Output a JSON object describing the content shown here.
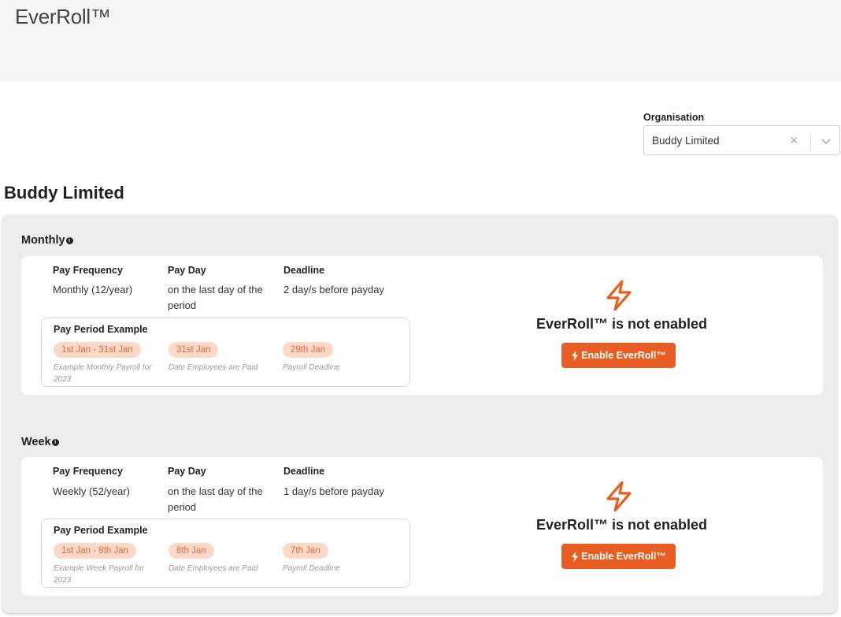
{
  "app": {
    "title": "EverRoll™"
  },
  "organisation": {
    "label": "Organisation",
    "value": "Buddy Limited",
    "clear_icon": "×"
  },
  "company": {
    "title": "Buddy Limited"
  },
  "colors": {
    "accent": "#e85d22",
    "pill_bg": "#fbd9c8",
    "pill_text": "#d66a3c"
  },
  "schedules": [
    {
      "title": "Monthly",
      "headers": {
        "frequency": "Pay Frequency",
        "payday": "Pay Day",
        "deadline": "Deadline"
      },
      "frequency": "Monthly (12/year)",
      "payday": "on the last day of the period",
      "deadline": "2 day/s before payday",
      "example": {
        "title": "Pay Period Example",
        "period": "1st Jan - 31st Jan",
        "period_caption": "Example Monthly Payroll for 2023",
        "paid": "31st Jan",
        "paid_caption": "Date Employees are Paid",
        "deadline": "29th Jan",
        "deadline_caption": "Payroll Deadline"
      },
      "status": "EverRoll™ is not enabled",
      "button": "Enable EverRoll™"
    },
    {
      "title": "Week",
      "headers": {
        "frequency": "Pay Frequency",
        "payday": "Pay Day",
        "deadline": "Deadline"
      },
      "frequency": "Weekly (52/year)",
      "payday": "on the last day of the period",
      "deadline": "1 day/s before payday",
      "example": {
        "title": "Pay Period Example",
        "period": "1st Jan - 8th Jan",
        "period_caption": "Example Week Payroll for 2023",
        "paid": "8th Jan",
        "paid_caption": "Date Employees are Paid",
        "deadline": "7th Jan",
        "deadline_caption": "Payroll Deadline"
      },
      "status": "EverRoll™ is not enabled",
      "button": "Enable EverRoll™"
    }
  ]
}
